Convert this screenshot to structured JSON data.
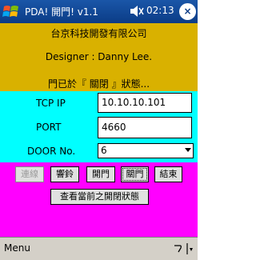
{
  "titlebar": {
    "title": "PDA! 開門! v1.1",
    "clock": "02:13",
    "close_label": "×",
    "icons": {
      "start": "windows-start-icon",
      "volume": "speaker-icon"
    }
  },
  "info": {
    "company": "台京科技開發有限公司",
    "designer": "Designer : Danny Lee.",
    "status": "門已於『 關閉 』狀態..."
  },
  "form": {
    "tcp_ip_label": "TCP IP",
    "tcp_ip_value": "10.10.10.101",
    "port_label": "PORT",
    "port_value": "4660",
    "door_label": "DOOR No.",
    "door_value": "6"
  },
  "buttons": {
    "connect": "連線",
    "ring": "響鈴",
    "open": "開門",
    "close": "關門",
    "end": "結束",
    "query": "查看當前之開閉狀態"
  },
  "menubar": {
    "menu_label": "Menu"
  },
  "colors": {
    "titlebar": "#0b3c86",
    "info_panel": "#d9b100",
    "form_panel": "#00ffff",
    "button_panel": "#ff00ff",
    "menubar": "#d4d0c8"
  }
}
